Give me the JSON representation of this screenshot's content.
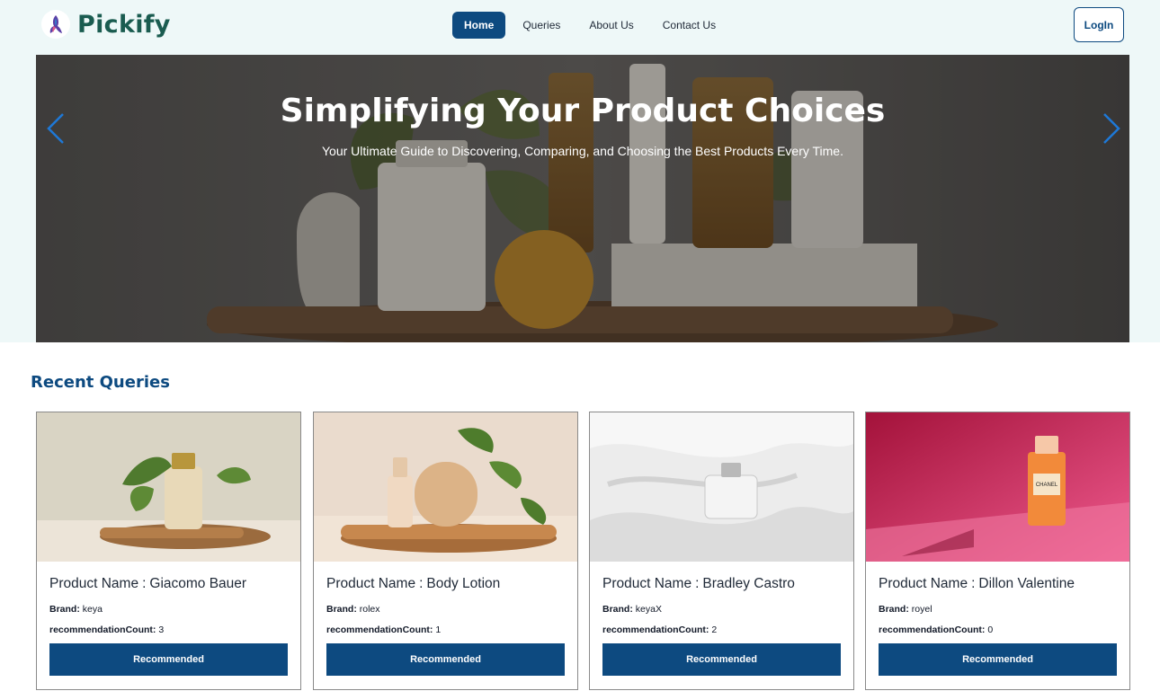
{
  "brand": {
    "name": "Pickify",
    "logo_icon": "hummingbird-icon"
  },
  "nav": {
    "links": [
      {
        "label": "Home",
        "active": true
      },
      {
        "label": "Queries",
        "active": false
      },
      {
        "label": "About Us",
        "active": false
      },
      {
        "label": "Contact Us",
        "active": false
      }
    ],
    "login_label": "LogIn"
  },
  "hero": {
    "title": "Simplifying Your Product Choices",
    "subtitle": "Your Ultimate Guide to Discovering, Comparing, and Choosing the Best Products Every Time.",
    "prev_icon": "chevron-left-icon",
    "next_icon": "chevron-right-icon"
  },
  "recent": {
    "title": "Recent Queries",
    "cards": [
      {
        "name_label": "Product Name",
        "name_sep": ":",
        "product_name": "Giacomo Bauer",
        "brand_label": "Brand:",
        "brand": "keya",
        "count_label": "recommendationCount:",
        "count": "3",
        "button": "Recommended"
      },
      {
        "name_label": "Product Name",
        "name_sep": ":",
        "product_name": "Body Lotion",
        "brand_label": "Brand:",
        "brand": "rolex",
        "count_label": "recommendationCount:",
        "count": "1",
        "button": "Recommended"
      },
      {
        "name_label": "Product Name",
        "name_sep": ":",
        "product_name": "Bradley Castro",
        "brand_label": "Brand:",
        "brand": "keyaX",
        "count_label": "recommendationCount:",
        "count": "2",
        "button": "Recommended"
      },
      {
        "name_label": "Product Name",
        "name_sep": ":",
        "product_name": "Dillon Valentine",
        "brand_label": "Brand:",
        "brand": "royel",
        "count_label": "recommendationCount:",
        "count": "0",
        "button": "Recommended"
      }
    ],
    "card_images": {
      "0": {
        "label": ""
      },
      "1": {
        "label": ""
      },
      "2": {
        "label": ""
      },
      "3": {
        "label": "CHANEL"
      }
    }
  },
  "colors": {
    "primary": "#0d4a80",
    "brand_text": "#1a5c50",
    "top_band": "#eef8f8"
  }
}
